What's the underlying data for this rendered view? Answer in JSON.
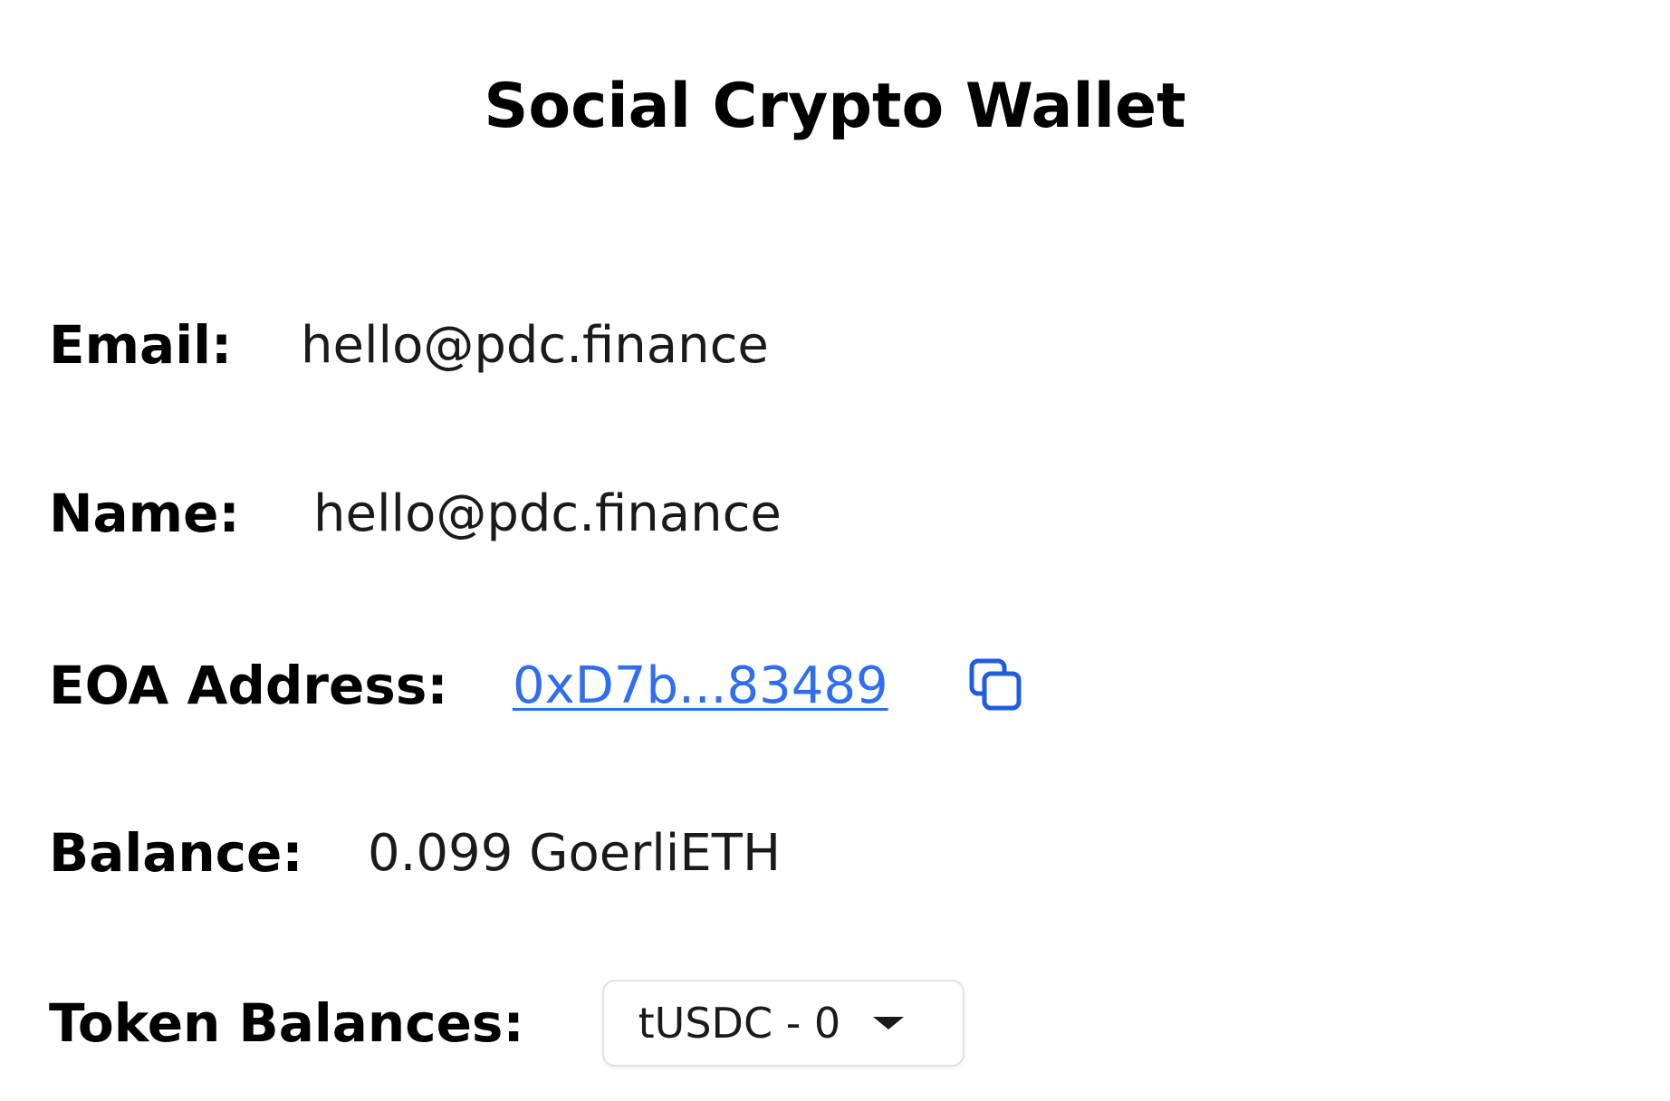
{
  "header": {
    "title": "Social Crypto Wallet"
  },
  "profile": {
    "email_label": "Email:",
    "email_value": "hello@pdc.finance",
    "name_label": "Name:",
    "name_value": "hello@pdc.finance",
    "eoa_label": "EOA Address:",
    "eoa_value": "0xD7b...83489",
    "copy_icon": "copy-icon",
    "balance_label": "Balance:",
    "balance_value": "0.099 GoerliETH",
    "token_label": "Token Balances:",
    "token_selected": "tUSDC - 0",
    "token_dropdown_icon": "caret-down-icon"
  },
  "colors": {
    "link": "#2f6ef0",
    "copy_icon": "#1f5ce0",
    "text": "#000000"
  }
}
